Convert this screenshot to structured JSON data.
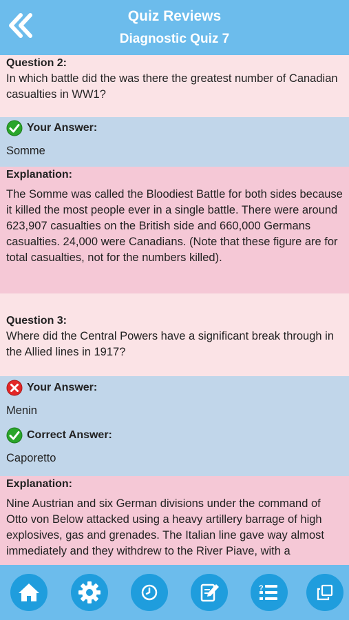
{
  "header": {
    "title": "Quiz Reviews",
    "subtitle": "Diagnostic Quiz 7"
  },
  "colors": {
    "header": "#6cbcec",
    "question_bg": "#fbe3e6",
    "answer_bg": "#c1d6ea",
    "explanation_bg": "#f5c8d6",
    "correct": "#2aa52a",
    "wrong": "#e32626"
  },
  "q2": {
    "label": "Question 2:",
    "text": "In which battle did the was there the greatest number of Canadian casualties in WW1?",
    "your_answer_label": "Your Answer:",
    "your_answer": "Somme",
    "explanation_label": "Explanation:",
    "explanation": "The Somme was called the Bloodiest Battle for both sides because it killed the most people ever in a single battle. There were around 623,907 casualties on the British side and 660,000 Germans casualties. 24,000 were Canadians. (Note that these figure are for total casualties, not for the numbers killed)."
  },
  "q3": {
    "label": "Question 3:",
    "text": "Where did the Central Powers have a significant break through in the Allied lines in 1917?",
    "your_answer_label": "Your Answer:",
    "your_answer": "Menin",
    "correct_answer_label": "Correct Answer:",
    "correct_answer": "Caporetto",
    "explanation_label": "Explanation:",
    "explanation": "Nine Austrian and six German divisions under the command of Otto von Below attacked using a heavy artillery barrage of high explosives, gas and grenades. The Italian line gave way almost immediately and they withdrew to the River Piave, with a"
  },
  "footer": {
    "icons": [
      "home-icon",
      "settings-icon",
      "clock-icon",
      "edit-icon",
      "quiz-list-icon",
      "copy-icon"
    ]
  }
}
